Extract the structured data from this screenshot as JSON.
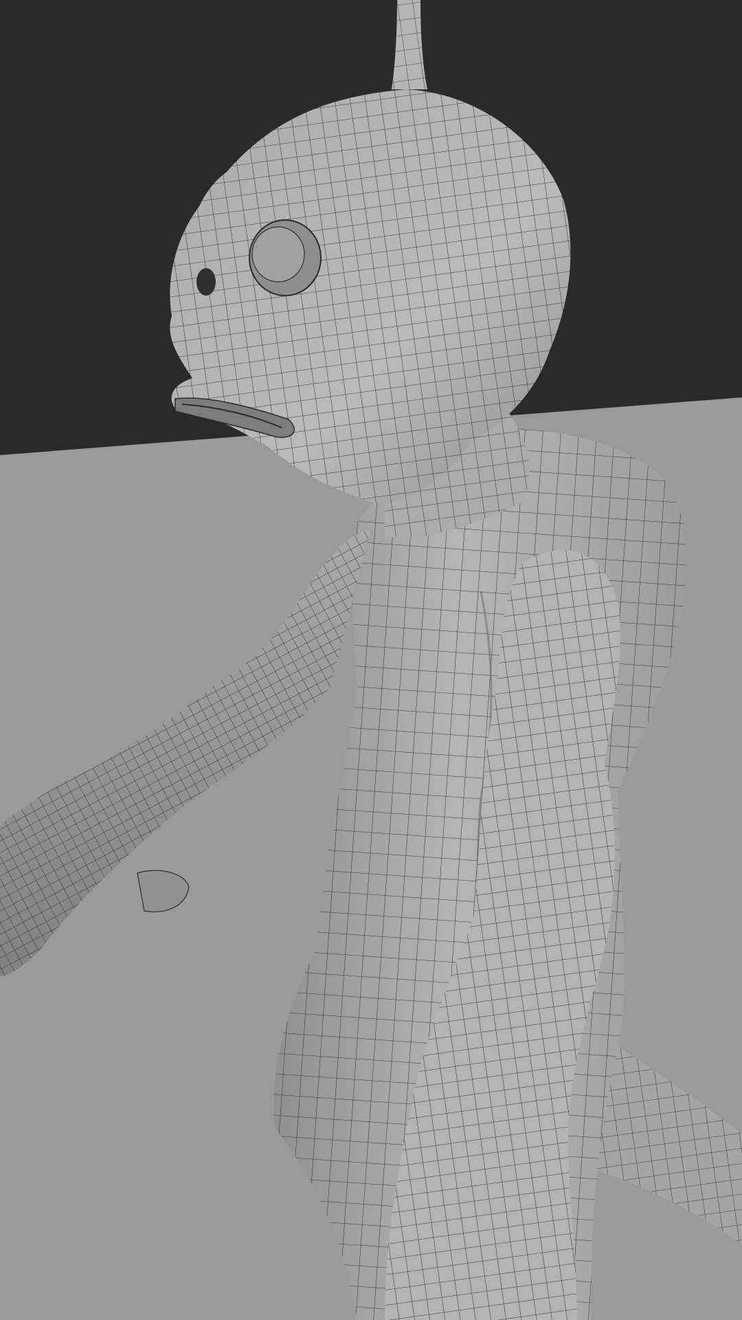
{
  "scene": {
    "colors": {
      "backdrop": "#2a2a2a",
      "floor": "#9a9a9a",
      "mesh_light": "#b9bcbc",
      "mesh_mid": "#a2a5a5",
      "mesh_shadow": "#777a7a",
      "wire": "#2b2b2b"
    }
  }
}
